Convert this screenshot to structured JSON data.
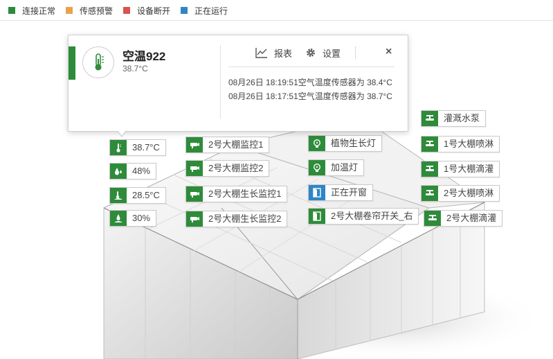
{
  "legend": [
    {
      "label": "连接正常",
      "color": "#2e8b3a"
    },
    {
      "label": "传感预警",
      "color": "#e8a34a"
    },
    {
      "label": "设备断开",
      "color": "#d9534f"
    },
    {
      "label": "正在运行",
      "color": "#2d86c8"
    }
  ],
  "popup": {
    "name": "空温922",
    "value": "38.7°C",
    "report_label": "报表",
    "settings_label": "设置",
    "close_label": "×",
    "logs": [
      "08月26日 18:19:51空气温度传感器为 38.4°C",
      "08月26日 18:17:51空气温度传感器为 38.7°C"
    ]
  },
  "sensors": [
    {
      "label": "38.7°C",
      "icon": "thermometer-icon",
      "status_color": "#2e8b3a"
    },
    {
      "label": "48%",
      "icon": "water-drop-icon",
      "status_color": "#2e8b3a"
    },
    {
      "label": "28.5°C",
      "icon": "soil-thermometer-icon",
      "status_color": "#2e8b3a"
    },
    {
      "label": "30%",
      "icon": "soil-moisture-icon",
      "status_color": "#2e8b3a"
    }
  ],
  "cameras": [
    {
      "label": "2号大棚监控1",
      "icon": "camera-icon"
    },
    {
      "label": "2号大棚监控2",
      "icon": "camera-icon"
    },
    {
      "label": "2号大棚生长监控1",
      "icon": "camera-icon"
    },
    {
      "label": "2号大棚生长监控2",
      "icon": "camera-icon"
    }
  ],
  "lights_and_windows": [
    {
      "label": "植物生长灯",
      "icon": "bulb-icon",
      "status_color": "#2e8b3a"
    },
    {
      "label": "加温灯",
      "icon": "bulb-icon",
      "status_color": "#2e8b3a"
    },
    {
      "label": "正在开窗",
      "icon": "window-icon",
      "status_color": "#2d86c8"
    },
    {
      "label": "2号大棚卷帘开关_右",
      "icon": "window-icon",
      "status_color": "#2e8b3a"
    }
  ],
  "valves": [
    {
      "label": "灌溉水泵",
      "icon": "valve-icon"
    },
    {
      "label": "1号大棚喷淋",
      "icon": "valve-icon"
    },
    {
      "label": "1号大棚滴灌",
      "icon": "valve-icon"
    },
    {
      "label": "2号大棚喷淋",
      "icon": "valve-icon"
    },
    {
      "label": "2号大棚滴灌",
      "icon": "valve-icon"
    }
  ]
}
